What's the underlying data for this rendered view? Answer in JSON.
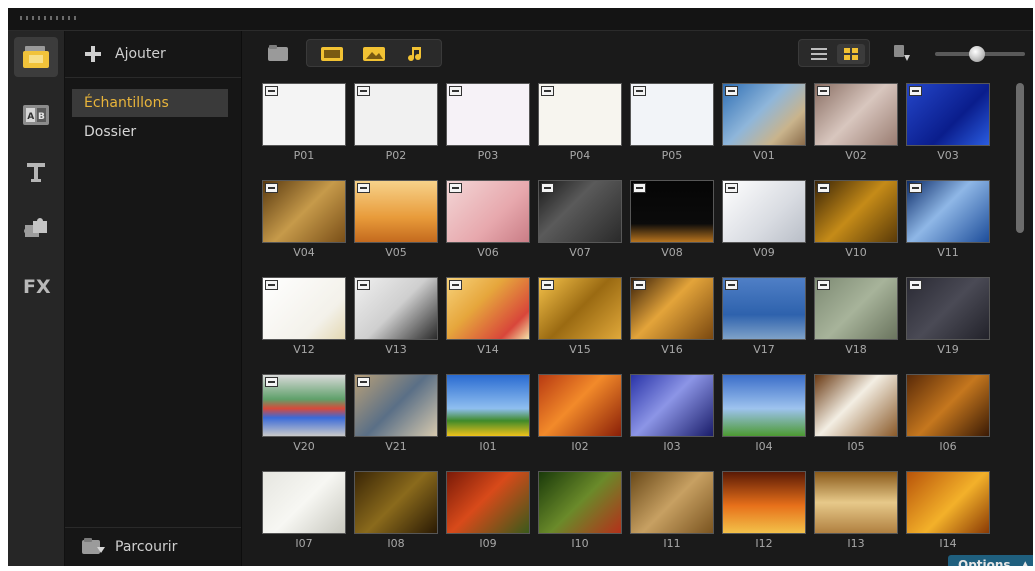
{
  "left_panel": {
    "add_label": "Ajouter",
    "folders": [
      {
        "label": "Échantillons",
        "selected": true
      },
      {
        "label": "Dossier",
        "selected": false
      }
    ],
    "browse_label": "Parcourir"
  },
  "main": {
    "options_label": "Options"
  },
  "thumbnails": [
    {
      "label": "P01",
      "bg": "#f4f4f4",
      "tagged": true
    },
    {
      "label": "P02",
      "bg": "#f1f1f1",
      "tagged": true
    },
    {
      "label": "P03",
      "bg": "#f6f2f7",
      "tagged": true
    },
    {
      "label": "P04",
      "bg": "#f7f5ef",
      "tagged": true
    },
    {
      "label": "P05",
      "bg": "#f2f4f8",
      "tagged": true
    },
    {
      "label": "V01",
      "bg": "linear-gradient(135deg,#2f6fb5,#8fb6da 45%,#c9b48c 75%,#8a6b4a)",
      "tagged": true
    },
    {
      "label": "V02",
      "bg": "linear-gradient(135deg,#8a6f64,#d8c6be 50%,#9a7d72)",
      "tagged": true
    },
    {
      "label": "V03",
      "bg": "linear-gradient(135deg,#2446c9,#0a1d8c 60%,#2a5ce0)",
      "tagged": true
    },
    {
      "label": "V04",
      "bg": "linear-gradient(135deg,#5a3a10,#c69a4a 50%,#7a4f18)",
      "tagged": true
    },
    {
      "label": "V05",
      "bg": "linear-gradient(180deg,#f7d28a,#e89b3a 60%,#c46a1e)",
      "tagged": true
    },
    {
      "label": "V06",
      "bg": "linear-gradient(135deg,#f3d6d6,#e7a8ad 60%,#c97d86)",
      "tagged": true
    },
    {
      "label": "V07",
      "bg": "linear-gradient(135deg,#1a1a1a,#5a5a5a 40%,#2a2a2a)",
      "tagged": true
    },
    {
      "label": "V08",
      "bg": "linear-gradient(180deg,#050505,#0b0b0b 70%,#b8741e)",
      "tagged": true
    },
    {
      "label": "V09",
      "bg": "linear-gradient(135deg,#ffffff,#d9dce2 60%,#b9bec7)",
      "tagged": true
    },
    {
      "label": "V10",
      "bg": "linear-gradient(135deg,#3a2406,#c58b18 50%,#5a3a08)",
      "tagged": true
    },
    {
      "label": "V11",
      "bg": "linear-gradient(135deg,#0d2d6a,#8fb7e6 45%,#1d4d9a)",
      "tagged": true
    },
    {
      "label": "V12",
      "bg": "linear-gradient(135deg,#ffffff,#f3f1ea 70%,#e4d8b2)",
      "tagged": true
    },
    {
      "label": "V13",
      "bg": "linear-gradient(135deg,#f0f0f0,#cfcfcf 50%,#2a2a2a)",
      "tagged": true
    },
    {
      "label": "V14",
      "bg": "linear-gradient(135deg,#f7d27a,#e6a63c 40%,#d8463a 80%,#f3e2a9)",
      "tagged": true
    },
    {
      "label": "V15",
      "bg": "linear-gradient(135deg,#f5c24a,#9a6a12 50%,#e0a83a)",
      "tagged": true
    },
    {
      "label": "V16",
      "bg": "linear-gradient(135deg,#3a2008,#e3a43a 45%,#7a4810)",
      "tagged": true
    },
    {
      "label": "V17",
      "bg": "linear-gradient(180deg,#4f7fc6,#2e62ad 60%,#7fa2c8)",
      "tagged": true
    },
    {
      "label": "V18",
      "bg": "linear-gradient(135deg,#7d8a73,#a7b39a 50%,#6a745e)",
      "tagged": true
    },
    {
      "label": "V19",
      "bg": "linear-gradient(135deg,#2a2a34,#4a4a55 50%,#22222a)",
      "tagged": true
    },
    {
      "label": "V20",
      "bg": "linear-gradient(180deg,#d9d9d9,#5fa06a 40%,#d84a3a 55%,#3a6ad8 70%,#c9c9c9)",
      "tagged": true
    },
    {
      "label": "V21",
      "bg": "linear-gradient(135deg,#b8a079,#5a6f86 50%,#d6c9ae)",
      "tagged": true
    },
    {
      "label": "I01",
      "bg": "linear-gradient(180deg,#2a6bd1,#8fbff0 55%,#3f8a2a 75%,#f0c21a)",
      "tagged": false
    },
    {
      "label": "I02",
      "bg": "linear-gradient(135deg,#b83a12,#f28a2a 45%,#8a1f08)",
      "tagged": false
    },
    {
      "label": "I03",
      "bg": "linear-gradient(135deg,#2a34a8,#8c95e6 45%,#1a1d6a)",
      "tagged": false
    },
    {
      "label": "I04",
      "bg": "linear-gradient(180deg,#3b6ec9,#9ec3ee 55%,#4c9a32)",
      "tagged": false
    },
    {
      "label": "I05",
      "bg": "linear-gradient(135deg,#6a3a14,#f3eee3 45%,#8a5a2a)",
      "tagged": false
    },
    {
      "label": "I06",
      "bg": "linear-gradient(135deg,#5a2a08,#c5771e 50%,#3a1a05)",
      "tagged": false
    },
    {
      "label": "I07",
      "bg": "linear-gradient(135deg,#e6e6e0,#f7f7f3 50%,#c8c8bf)",
      "tagged": false
    },
    {
      "label": "I08",
      "bg": "linear-gradient(135deg,#3a2606,#8a6a1c 50%,#2a1a04)",
      "tagged": false
    },
    {
      "label": "I09",
      "bg": "linear-gradient(135deg,#7a1a08,#d84a1a 45%,#3a5a1a)",
      "tagged": false
    },
    {
      "label": "I10",
      "bg": "linear-gradient(135deg,#1a3a0a,#6a8a2a 50%,#b4301a)",
      "tagged": false
    },
    {
      "label": "I11",
      "bg": "linear-gradient(135deg,#6a4a1a,#c7a062 50%,#7a5420)",
      "tagged": false
    },
    {
      "label": "I12",
      "bg": "linear-gradient(180deg,#5a1a05,#e7701a 55%,#f3c24a)",
      "tagged": false
    },
    {
      "label": "I13",
      "bg": "linear-gradient(180deg,#8a5a1a,#e7c98a 50%,#b08040)",
      "tagged": false
    },
    {
      "label": "I14",
      "bg": "linear-gradient(135deg,#b8540a,#f3b12a 55%,#8a3a05)",
      "tagged": false
    }
  ]
}
